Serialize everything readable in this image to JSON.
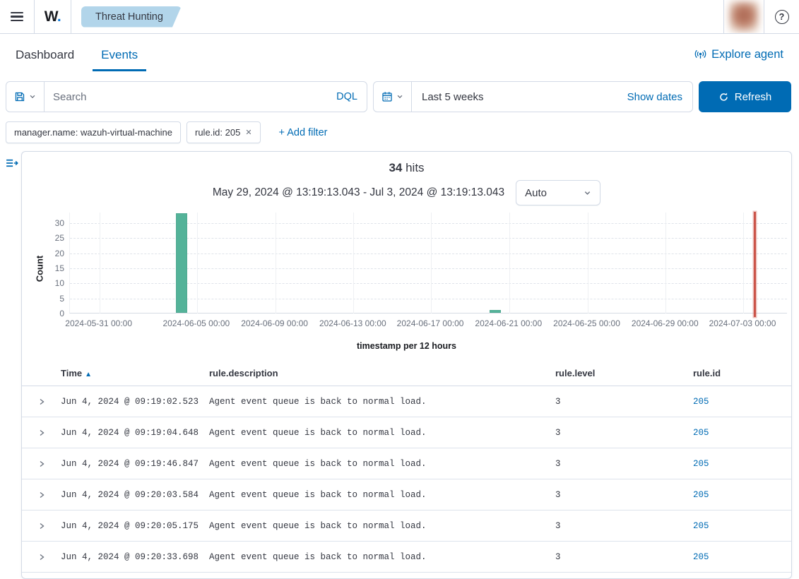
{
  "topbar": {
    "logo_text": "W",
    "logo_dot": ".",
    "breadcrumb": "Threat Hunting",
    "help_label": "?"
  },
  "tabs": {
    "dashboard": "Dashboard",
    "events": "Events",
    "explore_agent": "Explore agent"
  },
  "query": {
    "search_placeholder": "Search",
    "dql": "DQL",
    "time_range": "Last 5 weeks",
    "show_dates": "Show dates",
    "refresh": "Refresh"
  },
  "filters": {
    "pills": [
      {
        "label": "manager.name: wazuh-virtual-machine",
        "removable": false
      },
      {
        "label": "rule.id: 205",
        "removable": true
      }
    ],
    "add_label": "+ Add filter"
  },
  "results": {
    "hits": "34",
    "hits_suffix": " hits",
    "range": "May 29, 2024 @ 13:19:13.043 - Jul 3, 2024 @ 13:19:13.043",
    "interval": "Auto"
  },
  "chart_data": {
    "type": "bar",
    "title": "34 hits",
    "xlabel": "timestamp per 12 hours",
    "ylabel": "Count",
    "ylim": [
      0,
      33.5
    ],
    "y_ticks": [
      0,
      5,
      10,
      15,
      20,
      25,
      30
    ],
    "x_tick_labels": [
      "2024-05-31 00:00",
      "2024-06-05 00:00",
      "2024-06-09 00:00",
      "2024-06-13 00:00",
      "2024-06-17 00:00",
      "2024-06-21 00:00",
      "2024-06-25 00:00",
      "2024-06-29 00:00",
      "2024-07-03 00:00"
    ],
    "x_tick_fracs": [
      0.041,
      0.177,
      0.286,
      0.395,
      0.503,
      0.612,
      0.721,
      0.83,
      0.938
    ],
    "bars": [
      {
        "bucket": "2024-06-04 00:00",
        "value": 33,
        "frac": 0.156
      },
      {
        "bucket": "2024-06-20 00:00",
        "value": 1,
        "frac": 0.593
      }
    ],
    "now_line": {
      "frac": 0.954
    },
    "bar_color": "#54b399",
    "now_color": "#cb5449",
    "grid": true,
    "legend": false
  },
  "table": {
    "columns": [
      "Time",
      "rule.description",
      "rule.level",
      "rule.id"
    ],
    "sorted_column": "Time",
    "sort_direction": "asc",
    "rows": [
      {
        "time": "Jun 4, 2024 @ 09:19:02.523",
        "description": "Agent event queue is back to normal load.",
        "level": "3",
        "id": "205"
      },
      {
        "time": "Jun 4, 2024 @ 09:19:04.648",
        "description": "Agent event queue is back to normal load.",
        "level": "3",
        "id": "205"
      },
      {
        "time": "Jun 4, 2024 @ 09:19:46.847",
        "description": "Agent event queue is back to normal load.",
        "level": "3",
        "id": "205"
      },
      {
        "time": "Jun 4, 2024 @ 09:20:03.584",
        "description": "Agent event queue is back to normal load.",
        "level": "3",
        "id": "205"
      },
      {
        "time": "Jun 4, 2024 @ 09:20:05.175",
        "description": "Agent event queue is back to normal load.",
        "level": "3",
        "id": "205"
      },
      {
        "time": "Jun 4, 2024 @ 09:20:33.698",
        "description": "Agent event queue is back to normal load.",
        "level": "3",
        "id": "205"
      }
    ]
  },
  "colors": {
    "primary": "#006bb4",
    "border": "#d3dae6",
    "text": "#343741",
    "muted": "#69707d",
    "badge_bg": "#b2d5ea",
    "bar_green": "#54b399",
    "now_red": "#cb5449"
  }
}
